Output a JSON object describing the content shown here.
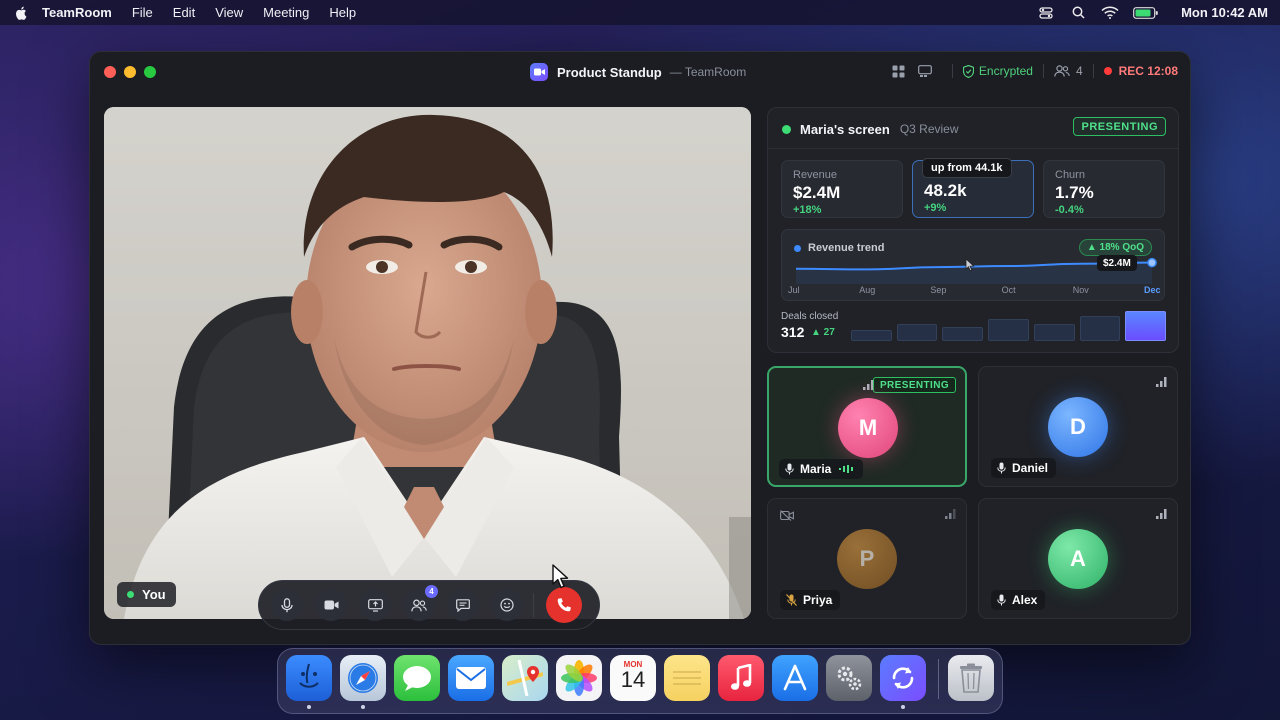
{
  "menubar": {
    "app_name": "TeamRoom",
    "menus": [
      "File",
      "Edit",
      "View",
      "Meeting",
      "Help"
    ],
    "clock": "Mon 10:42 AM"
  },
  "window": {
    "title": "Product Standup",
    "subtitle": "— TeamRoom",
    "encrypted_label": "Encrypted",
    "participant_count": "4",
    "rec_label": "REC 12:08"
  },
  "main_video": {
    "self_label": "You",
    "people_badge": "4"
  },
  "share": {
    "title": "Maria's screen",
    "subtitle": "Q3 Review",
    "presenting_label": "PRESENTING",
    "kpis": [
      {
        "label": "Revenue",
        "value": "$2.4M",
        "delta": "+18%"
      },
      {
        "label": "",
        "value": "48.2k",
        "delta": "+9%",
        "tooltip": "up from 44.1k"
      },
      {
        "label": "Churn",
        "value": "1.7%",
        "delta": "-0.4%"
      }
    ],
    "trend": {
      "label": "Revenue trend",
      "badge": "▲ 18% QoQ",
      "end_value": "$2.4M"
    },
    "deals": {
      "label": "Deals closed",
      "value": "312",
      "delta": "▲ 27"
    }
  },
  "chart_data": [
    {
      "type": "line",
      "title": "Revenue trend",
      "categories": [
        "Jul",
        "Aug",
        "Sep",
        "Oct",
        "Nov",
        "Dec"
      ],
      "values": [
        0.4,
        0.38,
        0.46,
        0.5,
        0.58,
        0.62
      ],
      "end_label": "$2.4M",
      "accent": "#3d8bff"
    },
    {
      "type": "bar",
      "title": "Deals closed",
      "values": [
        0.35,
        0.55,
        0.45,
        0.72,
        0.55,
        0.82,
        1.0
      ]
    }
  ],
  "participants": [
    {
      "name": "Maria",
      "initial": "M",
      "pill": "PRESENTING",
      "color": "#e84f86"
    },
    {
      "name": "Daniel",
      "initial": "D",
      "color": "#3c86f0"
    },
    {
      "name": "Priya",
      "initial": "P",
      "color": "#a8702a"
    },
    {
      "name": "Alex",
      "initial": "A",
      "color": "#3ec77a"
    }
  ],
  "dock": {
    "calendar_month": "MON",
    "calendar_day": "14"
  },
  "colors": {
    "accent": "#5b7cff",
    "success": "#3ddc74",
    "danger": "#e5322d"
  }
}
